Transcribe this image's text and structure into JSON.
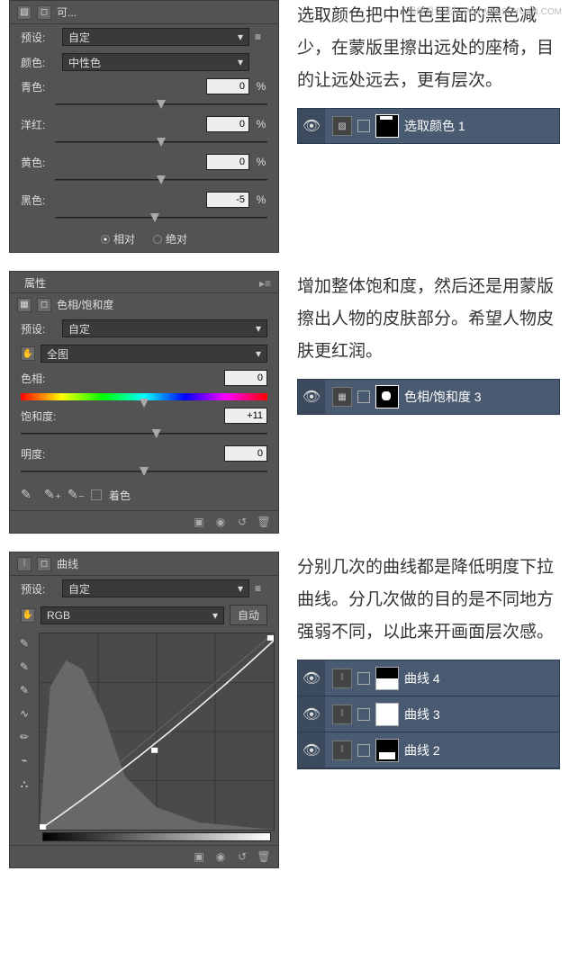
{
  "watermark": "思缘设计论坛  WWW.MISSYUAN.COM",
  "panel1": {
    "title": "可...",
    "preset_label": "预设:",
    "preset_value": "自定",
    "colors_label": "颜色:",
    "colors_value": "中性色",
    "cyan_label": "青色:",
    "cyan_value": "0",
    "pct": "%",
    "magenta_label": "洋红:",
    "magenta_value": "0",
    "yellow_label": "黄色:",
    "yellow_value": "0",
    "black_label": "黑色:",
    "black_value": "-5",
    "rel": "相对",
    "abs": "绝对"
  },
  "desc1": "选取颜色把中性色里面的黑色减少，在蒙版里擦出远处的座椅，目的让远处远去，更有层次。",
  "layer1": {
    "name": "选取颜色 1"
  },
  "panel2": {
    "tab": "属性",
    "title": "色相/饱和度",
    "preset_label": "预设:",
    "preset_value": "自定",
    "master": "全图",
    "hue_label": "色相:",
    "hue_value": "0",
    "sat_label": "饱和度:",
    "sat_value": "+11",
    "light_label": "明度:",
    "light_value": "0",
    "colorize": "着色"
  },
  "desc2": "增加整体饱和度，然后还是用蒙版擦出人物的皮肤部分。希望人物皮肤更红润。",
  "layer2": {
    "name": "色相/饱和度 3"
  },
  "panel3": {
    "title": "曲线",
    "preset_label": "预设:",
    "preset_value": "自定",
    "channel": "RGB",
    "auto": "自动"
  },
  "desc3": "分别几次的曲线都是降低明度下拉曲线。分几次做的目的是不同地方强弱不同，以此来开画面层次感。",
  "layers3": [
    {
      "name": "曲线 4"
    },
    {
      "name": "曲线 3"
    },
    {
      "name": "曲线 2"
    }
  ]
}
